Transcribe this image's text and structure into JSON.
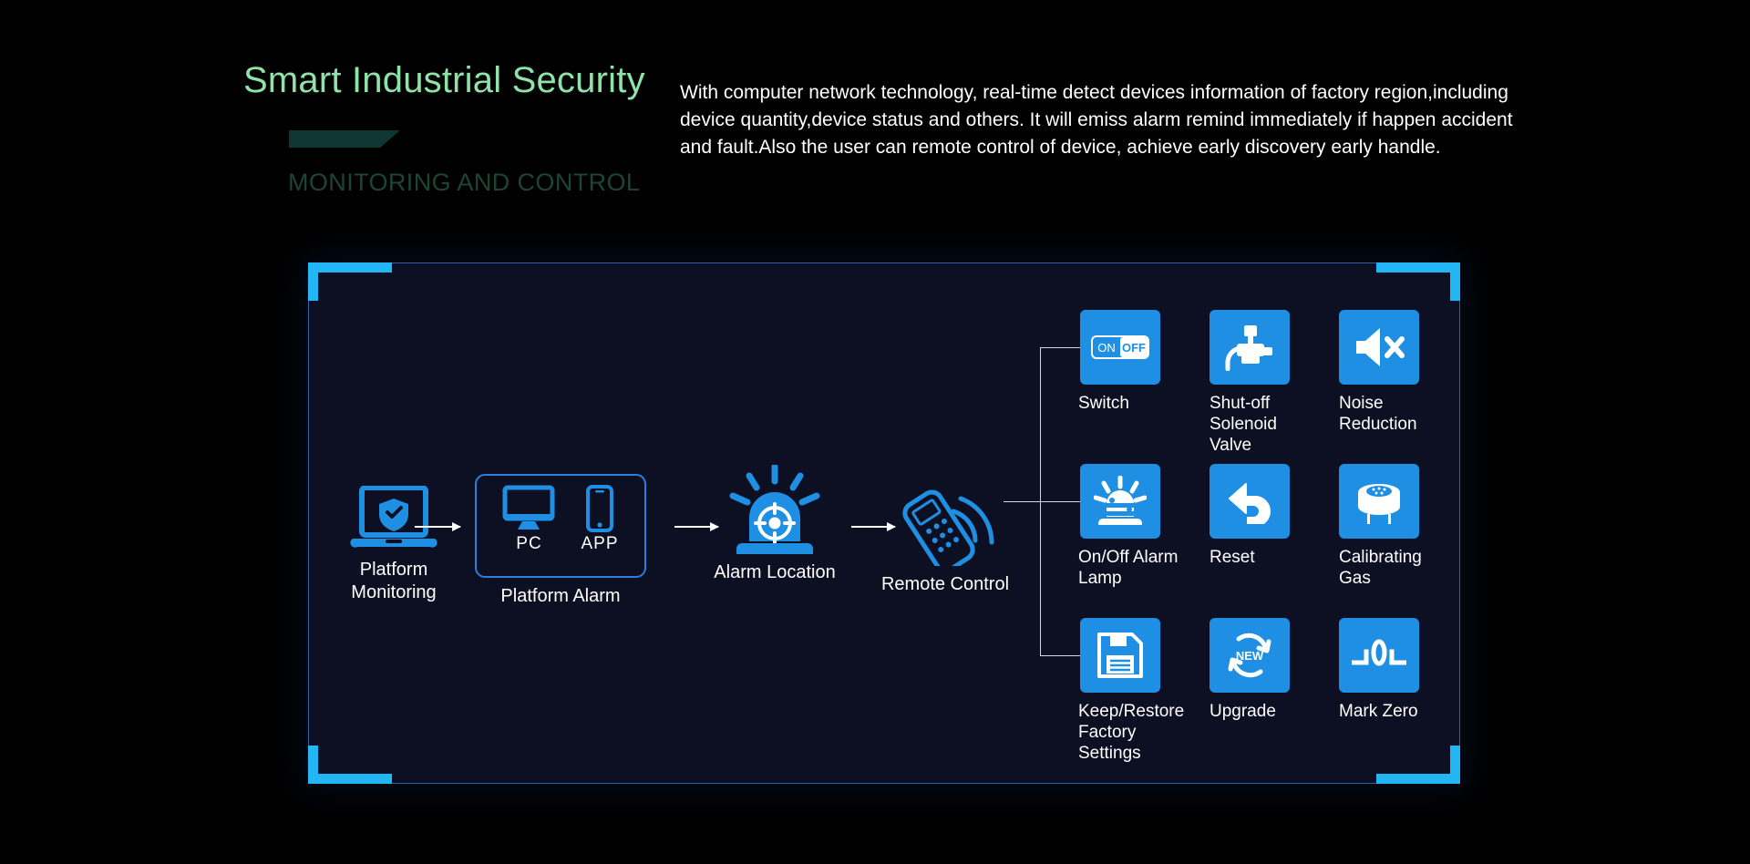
{
  "header": {
    "title": "Smart Industrial Security",
    "subtitle": "MONITORING AND CONTROL",
    "paragraph": "With computer network technology, real-time detect devices information of factory region,including device quantity,device status and others. It will emiss alarm remind immediately if happen accident and fault.Also the user can remote control of device, achieve early discovery early handle."
  },
  "colors": {
    "page_background": "#000000",
    "panel_background": "#0d1022",
    "panel_border": "#2d5ea8",
    "corner_accent": "#22b6f5",
    "title_green": "#8fe3a8",
    "subtitle_green": "#1d4536",
    "deco_teal": "#0e3733",
    "icon_blue": "#1e8fe3",
    "device_blue": "#2a7fe0",
    "text_white": "#ffffff",
    "connector_line": "#cfd9e8"
  },
  "flow": {
    "nodes": [
      {
        "label": "Platform\nMonitoring",
        "icon": "laptop-shield-icon"
      },
      {
        "label": "Platform Alarm",
        "icon": "platform-alarm-box"
      },
      {
        "label": "Alarm Location",
        "icon": "siren-target-icon"
      },
      {
        "label": "Remote Control",
        "icon": "remote-control-icon"
      }
    ],
    "devices": [
      {
        "label": "PC",
        "icon": "monitor-icon"
      },
      {
        "label": "APP",
        "icon": "smartphone-icon"
      }
    ],
    "arrows": 3
  },
  "controls": {
    "items": [
      {
        "label": "Switch",
        "icon": "on-off-toggle-icon",
        "toggle_on": "ON",
        "toggle_off": "OFF"
      },
      {
        "label": "Shut-off\nSolenoid Valve",
        "icon": "solenoid-valve-icon"
      },
      {
        "label": "Noise\nReduction",
        "icon": "speaker-mute-icon"
      },
      {
        "label": "On/Off Alarm\nLamp",
        "icon": "alarm-lamp-icon"
      },
      {
        "label": "Reset",
        "icon": "undo-arrow-icon"
      },
      {
        "label": "Calibrating\nGas",
        "icon": "gas-sensor-icon"
      },
      {
        "label": "Keep/Restore\nFactory Settings",
        "icon": "floppy-disk-icon"
      },
      {
        "label": "Upgrade",
        "icon": "refresh-new-icon",
        "badge": "NEW"
      },
      {
        "label": "Mark Zero",
        "icon": "mark-zero-icon"
      }
    ]
  }
}
